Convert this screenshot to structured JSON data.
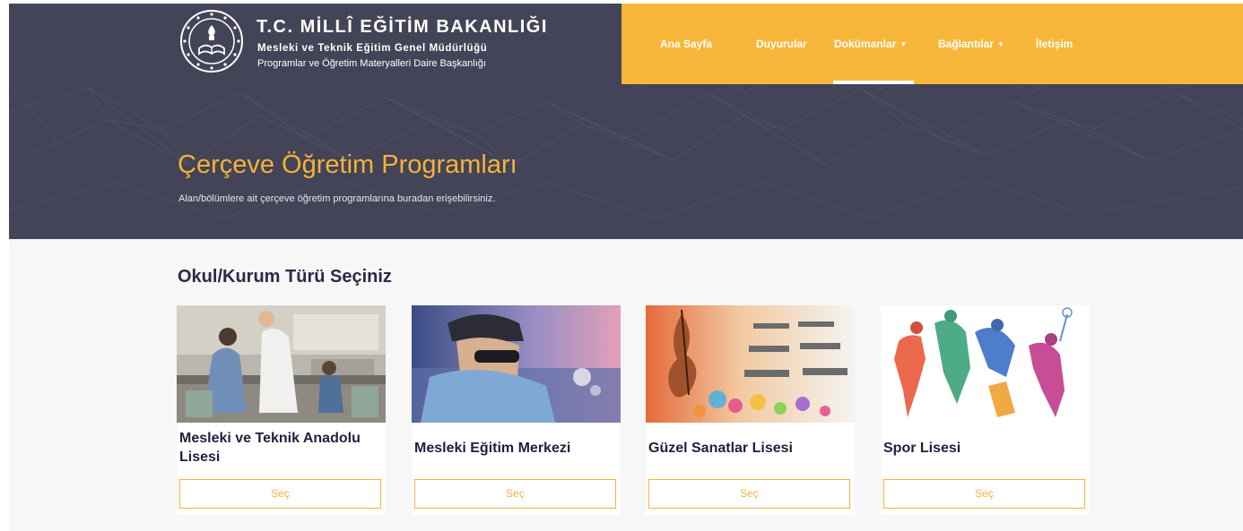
{
  "header": {
    "title": "T.C. MİLLÎ EĞİTİM BAKANLIĞI",
    "subtitle": "Mesleki ve Teknik Eğitim Genel Müdürlüğü",
    "department": "Programlar ve Öğretim Materyalleri Daire Başkanlığı",
    "logo_icon": "ministry-seal-icon"
  },
  "nav": {
    "items": [
      {
        "label": "Ana Sayfa"
      },
      {
        "label": "Duyurular"
      },
      {
        "label": "Dokümanlar",
        "dropdown": true,
        "active": true
      },
      {
        "label": "Bağlantılar",
        "dropdown": true
      },
      {
        "label": "İletişim"
      }
    ],
    "caret": "▼"
  },
  "hero": {
    "title": "Çerçeve Öğretim Programları",
    "subtitle": "Alan/bölümlere ait çerçeve öğretim programlarına buradan erişebilirsiniz."
  },
  "section": {
    "heading": "Okul/Kurum Türü Seçiniz"
  },
  "cards": [
    {
      "title": "Mesleki ve Teknik Anadolu Lisesi",
      "button": "Seç",
      "image": "laboratory-students-photo"
    },
    {
      "title": "Mesleki Eğitim Merkezi",
      "button": "Seç",
      "image": "welding-student-photo"
    },
    {
      "title": "Güzel Sanatlar Lisesi",
      "button": "Seç",
      "image": "violin-classroom-art"
    },
    {
      "title": "Spor Lisesi",
      "button": "Seç",
      "image": "athletes-watercolor-art"
    }
  ],
  "colors": {
    "accent": "#f8b73b",
    "hero_bg": "#434457",
    "heading": "#2a2b46"
  }
}
